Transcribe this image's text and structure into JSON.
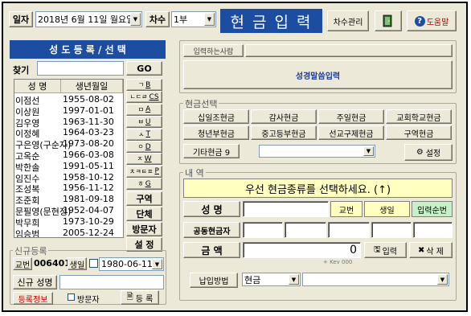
{
  "header": {
    "date_label": "일자",
    "date_value": "2018년  6월 11일 월요일",
    "round_label": "차수",
    "round_value": "1부",
    "title": "현 금 입 력",
    "round_manage_button": "차수관리",
    "help_button": "도움말"
  },
  "left": {
    "panel_title": "성 도 등 록 / 선 택",
    "search_label": "찾기",
    "search_value": "",
    "go_button": "GO",
    "columns": [
      "성  명",
      "생년월일"
    ],
    "members": [
      {
        "name": "이점선",
        "birth": "1955-08-02"
      },
      {
        "name": "이상원",
        "birth": "1997-01-01"
      },
      {
        "name": "김우영",
        "birth": "1963-11-30"
      },
      {
        "name": "이정혜",
        "birth": "1964-03-23"
      },
      {
        "name": "구은영(구순자)",
        "birth": "1973-08-20"
      },
      {
        "name": "고옥순",
        "birth": "1966-03-08"
      },
      {
        "name": "박한솔",
        "birth": "1991-05-11"
      },
      {
        "name": "임진수",
        "birth": "1958-10-12"
      },
      {
        "name": "조성복",
        "birth": "1956-11-12"
      },
      {
        "name": "조준회",
        "birth": "1981-09-18"
      },
      {
        "name": "문필영(문현정)",
        "birth": "1952-04-07"
      },
      {
        "name": "박무희",
        "birth": "1973-10-29"
      },
      {
        "name": "임승범",
        "birth": "2005-12-24"
      }
    ],
    "index_buttons": [
      "ㄱ",
      "ㄴㄷㄹ",
      "ㅁ",
      "ㅂ",
      "ㅅ",
      "ㅇ",
      "ㅈ",
      "ㅊㅋㅌㅍ",
      "ㅎ"
    ],
    "index_letters": [
      "B",
      "CS",
      "A",
      "U",
      "T",
      "D",
      "W",
      "P",
      "G"
    ],
    "district_button": "구역",
    "group_button": "단체",
    "visitor_button": "방문자",
    "settings_button": "설 정",
    "new_reg": {
      "title": "신규등록",
      "number_label": "교번",
      "number_value": "006401",
      "birth_label": "생일",
      "birth_value": "1980-06-11",
      "name_label": "신규 성명",
      "name_value": "",
      "reg_info_label": "등록정보",
      "visitor_label": "방문자",
      "register_button": "등 록"
    }
  },
  "right": {
    "entrant_label": "입력하는사람",
    "verse_input_label": "성경말씀입력",
    "offering_title": "현금선택",
    "offering_types": [
      [
        "십일조현금",
        "감사현금",
        "주일현금",
        "교회학교현금"
      ],
      [
        "청년부현금",
        "중고등부현금",
        "선교구제현금",
        "구역현금"
      ]
    ],
    "other_offering_label": "기타현금 9",
    "other_offering_value": "",
    "settings_button": "설정",
    "detail_title": "내  역",
    "notice": "우선 현금종류를 선택하세요. (↑)",
    "name_label": "성  명",
    "name_value": "",
    "number_label": "교번",
    "birthday_label": "생일",
    "input_order_label": "입력순번",
    "joint_label": "공동현금자",
    "amount_label": "금    액",
    "amount_value": "0",
    "key_hint": "+ Kev 000",
    "input_button": "입력",
    "delete_button": "삭 제",
    "payment_label": "납입방법",
    "payment_value": "현금",
    "payment_detail_value": ""
  }
}
